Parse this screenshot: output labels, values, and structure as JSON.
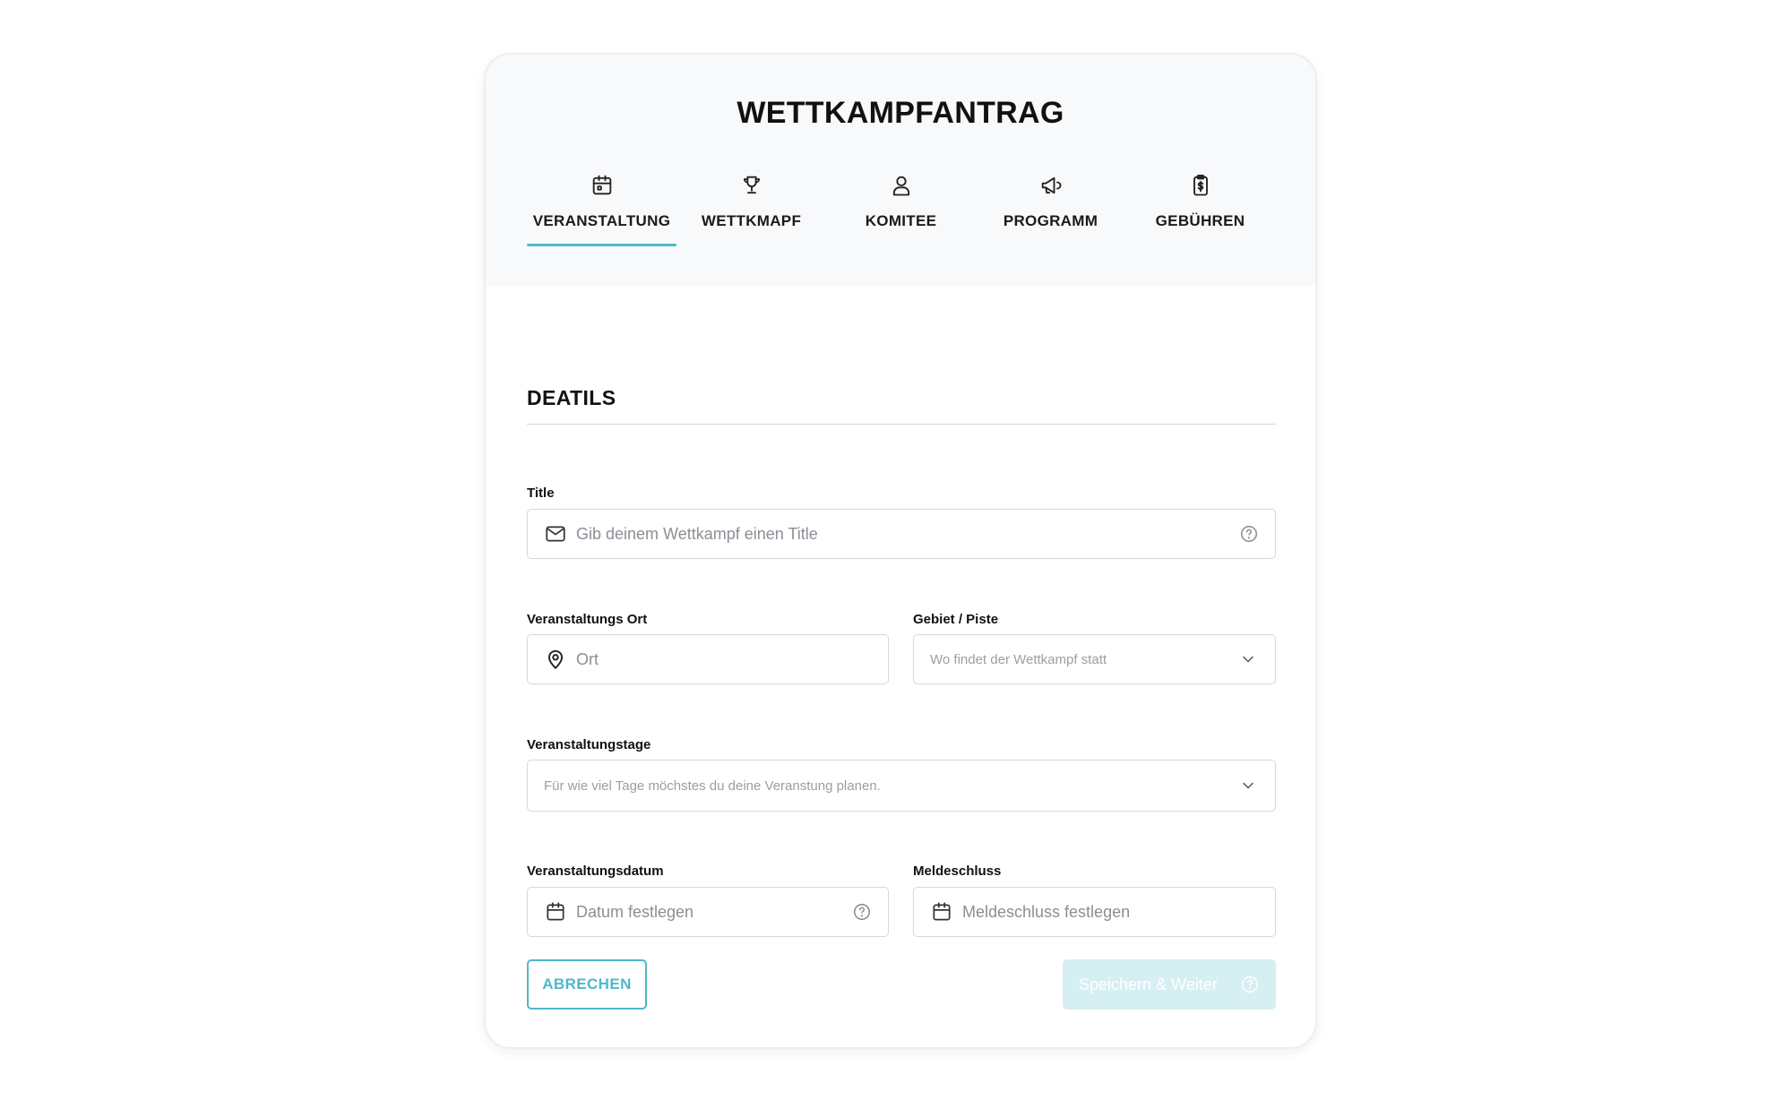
{
  "page": {
    "title": "WETTKAMPFANTRAG"
  },
  "tabs": [
    {
      "label": "VERANSTALTUNG",
      "icon": "calendar-icon",
      "active": true
    },
    {
      "label": "WETTKMAPF",
      "icon": "trophy-icon",
      "active": false
    },
    {
      "label": "KOMITEE",
      "icon": "user-icon",
      "active": false
    },
    {
      "label": "PROGRAMM",
      "icon": "megaphone-icon",
      "active": false
    },
    {
      "label": "GEBÜHREN",
      "icon": "clipboard-dollar-icon",
      "active": false
    }
  ],
  "section": {
    "title": "DEATILS"
  },
  "form": {
    "title": {
      "label": "Title",
      "placeholder": "Gib deinem Wettkampf einen Title",
      "icon": "mail-icon",
      "help_icon": "help-circle-icon"
    },
    "location": {
      "label": "Veranstaltungs Ort",
      "placeholder": "Ort",
      "icon": "map-pin-icon"
    },
    "area": {
      "label": "Gebiet / Piste",
      "placeholder": "Wo findet der Wettkampf statt",
      "icon": "chevron-down-icon"
    },
    "days": {
      "label": "Veranstaltungstage",
      "placeholder": "Für wie viel Tage möchstes du deine Veranstung planen.",
      "icon": "chevron-down-icon"
    },
    "date": {
      "label": "Veranstaltungsdatum",
      "placeholder": "Datum festlegen",
      "icon": "calendar-icon",
      "help_icon": "help-circle-icon"
    },
    "deadline": {
      "label": "Meldeschluss",
      "placeholder": "Meldeschluss festlegen",
      "icon": "calendar-icon"
    }
  },
  "actions": {
    "cancel_label": "ABRECHEN",
    "save_label": "Speichern & Weiter",
    "save_disabled": true
  },
  "colors": {
    "accent": "#4fb8c9",
    "accent_light": "#d6eff3",
    "header_bg": "#f8f9fb",
    "border": "#d5d8dc"
  }
}
